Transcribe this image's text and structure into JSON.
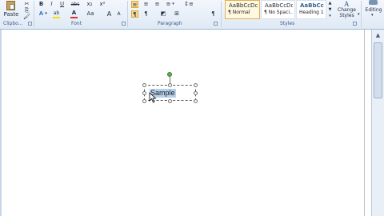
{
  "ribbon": {
    "clipboard": {
      "paste_label": "Paste",
      "group_label": "Clipbo..."
    },
    "font": {
      "group_label": "Font",
      "bold": "B",
      "italic": "I",
      "strikethrough": "abc",
      "subscript": "x₂",
      "superscript": "x²",
      "text_effects": "A",
      "highlight": "ab",
      "font_color": "A",
      "change_case": "Aa",
      "grow_font": "A",
      "shrink_font": "A"
    },
    "paragraph": {
      "group_label": "Paragraph",
      "show_marks": "¶"
    },
    "styles": {
      "group_label": "Styles",
      "gallery": [
        {
          "preview": "AaBbCcDc",
          "name": "¶ Normal"
        },
        {
          "preview": "AaBbCcDc",
          "name": "¶ No Spaci..."
        },
        {
          "preview": "AaBbCc",
          "name": "Heading 1"
        }
      ],
      "change_styles_label": "Change Styles",
      "change_styles_arrow": "▾"
    },
    "editing": {
      "label": "Editing"
    }
  },
  "document": {
    "textbox_text": "Sample"
  },
  "colors": {
    "selection": "#b7d0ec",
    "rotation_handle": "#5fae4b",
    "font_color_bar": "#e03131",
    "highlight_bar": "#f0e000"
  }
}
